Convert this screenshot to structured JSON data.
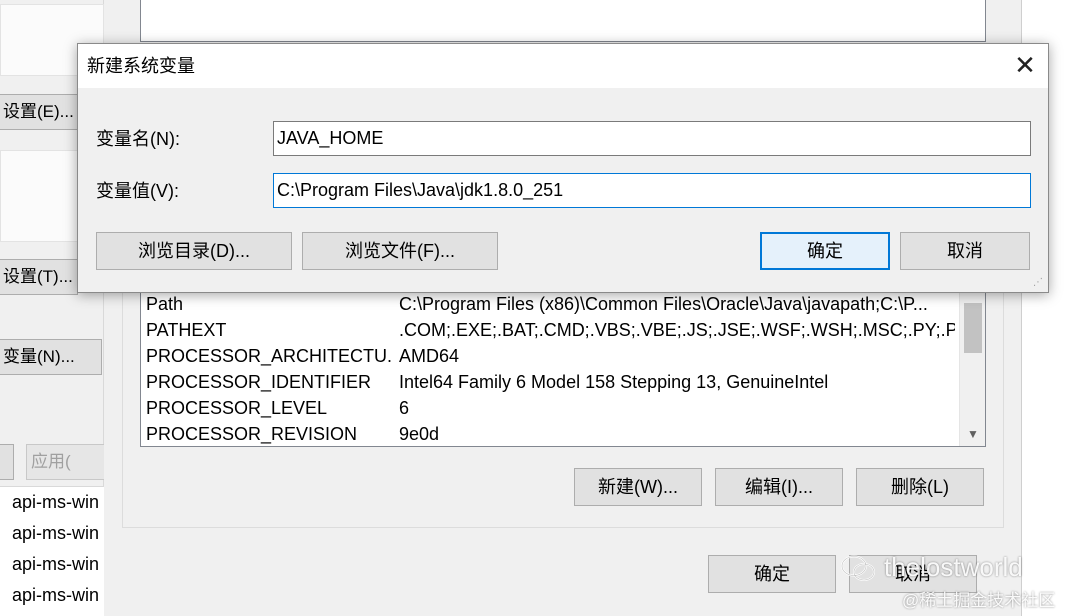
{
  "left_window": {
    "settings_e_label": "设置(E)...",
    "settings_t_label": "设置(T)...",
    "env_vars_label": "变量(N)...",
    "apply_label": "应用(",
    "list_items": [
      "api-ms-win",
      "api-ms-win",
      "api-ms-win",
      "api-ms-win"
    ]
  },
  "env_window": {
    "system_variables": [
      {
        "name": "Path",
        "value": "C:\\Program Files (x86)\\Common Files\\Oracle\\Java\\javapath;C:\\P..."
      },
      {
        "name": "PATHEXT",
        "value": ".COM;.EXE;.BAT;.CMD;.VBS;.VBE;.JS;.JSE;.WSF;.WSH;.MSC;.PY;.PY..."
      },
      {
        "name": "PROCESSOR_ARCHITECTU...",
        "value": "AMD64"
      },
      {
        "name": "PROCESSOR_IDENTIFIER",
        "value": "Intel64 Family 6 Model 158 Stepping 13, GenuineIntel"
      },
      {
        "name": "PROCESSOR_LEVEL",
        "value": "6"
      },
      {
        "name": "PROCESSOR_REVISION",
        "value": "9e0d"
      }
    ],
    "new_label": "新建(W)...",
    "edit_label": "编辑(I)...",
    "delete_label": "删除(L)",
    "ok_label": "确定",
    "cancel_label": "取消"
  },
  "dialog": {
    "title": "新建系统变量",
    "close_glyph": "✕",
    "name_label": "变量名(N):",
    "name_value": "JAVA_HOME",
    "value_label": "变量值(V):",
    "value_value": "C:\\Program Files\\Java\\jdk1.8.0_251",
    "browse_dir_label": "浏览目录(D)...",
    "browse_file_label": "浏览文件(F)...",
    "ok_label": "确定",
    "cancel_label": "取消"
  },
  "watermark": {
    "line1": "thelostworld",
    "line2": "@稀土掘金技术社区"
  }
}
